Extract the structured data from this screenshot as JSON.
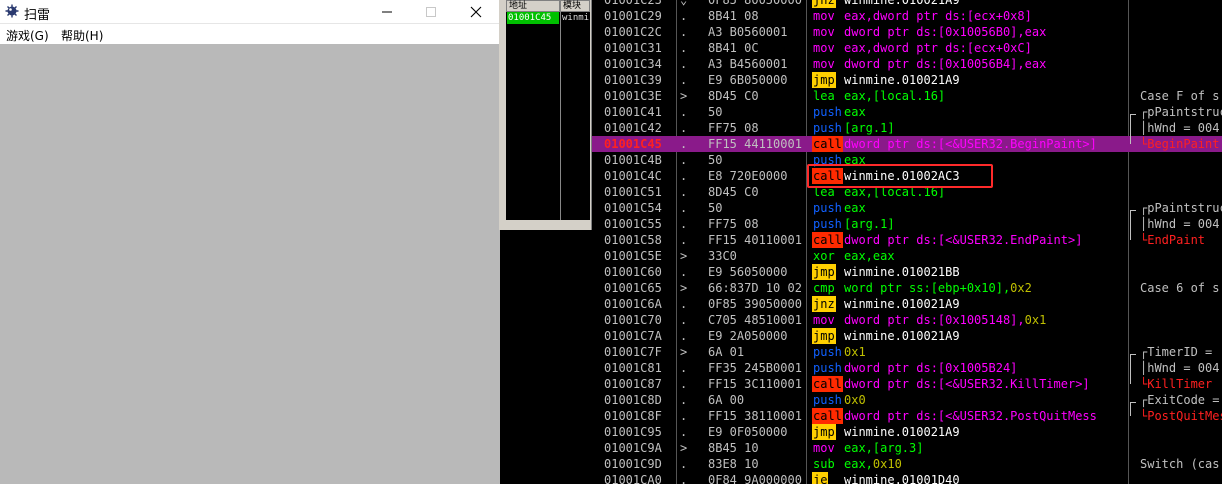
{
  "window": {
    "title": "扫雷",
    "menu": [
      "游戏(G)",
      "帮助(H)"
    ]
  },
  "memory_panel": {
    "col_address": "地址",
    "col_module": "模块",
    "row_address": "01001C45",
    "row_module": "winmi"
  },
  "rows": [
    {
      "addr": "01001C23",
      "jump": "⌄",
      "hex": "0F85 80050000",
      "mn": "jnz",
      "mnc": "jnzn",
      "op": [
        [
          "winmine.010021A9",
          "w"
        ]
      ],
      "cm": ""
    },
    {
      "addr": "01001C29",
      "jump": ".",
      "hex": "8B41 08",
      "mn": "mov",
      "mnc": "mov",
      "op": [
        [
          "eax,dword ptr ds:[ecx+0x8]",
          "mov"
        ]
      ],
      "cm": ""
    },
    {
      "addr": "01001C2C",
      "jump": ".",
      "hex": "A3 B0560001",
      "mn": "mov",
      "mnc": "mov",
      "op": [
        [
          "dword ptr ds:[0x10056B0],eax",
          "mov"
        ]
      ],
      "cm": ""
    },
    {
      "addr": "01001C31",
      "jump": ".",
      "hex": "8B41 0C",
      "mn": "mov",
      "mnc": "mov",
      "op": [
        [
          "eax,dword ptr ds:[ecx+0xC]",
          "mov"
        ]
      ],
      "cm": ""
    },
    {
      "addr": "01001C34",
      "jump": ".",
      "hex": "A3 B4560001",
      "mn": "mov",
      "mnc": "mov",
      "op": [
        [
          "dword ptr ds:[0x10056B4],eax",
          "mov"
        ]
      ],
      "cm": ""
    },
    {
      "addr": "01001C39",
      "jump": ".",
      "hex": "E9 6B050000",
      "mn": "jmp",
      "mnc": "jmpn",
      "op": [
        [
          "winmine.010021A9",
          "w"
        ]
      ],
      "cm": ""
    },
    {
      "addr": "01001C3E",
      "jump": ">",
      "hex": "8D45 C0",
      "mn": "lea",
      "mnc": "lea",
      "op": [
        [
          "eax,[local.16]",
          "g"
        ]
      ],
      "cm": "Case F of s",
      "cmc": "cw"
    },
    {
      "addr": "01001C41",
      "jump": ".",
      "hex": "50",
      "mn": "push",
      "mnc": "push",
      "op": [
        [
          "eax",
          "g"
        ]
      ],
      "cm": "┌pPaintstruc",
      "cmc": "cw"
    },
    {
      "addr": "01001C42",
      "jump": ".",
      "hex": "FF75 08",
      "mn": "push",
      "mnc": "push",
      "op": [
        [
          "[arg.1]",
          "g"
        ]
      ],
      "cm": "│hWnd = 004",
      "cmc": "cw"
    },
    {
      "addr": "01001C45",
      "jump": ".",
      "hex": "FF15 44110001",
      "mn": "call",
      "mnc": "calln",
      "op": [
        [
          "dword ptr ds:[<&USER32.BeginPaint>]",
          "mov"
        ]
      ],
      "cm": "└BeginPaint",
      "cmc": "cr",
      "sel": true
    },
    {
      "addr": "01001C4B",
      "jump": ".",
      "hex": "50",
      "mn": "push",
      "mnc": "push",
      "op": [
        [
          "eax",
          "g"
        ]
      ],
      "cm": ""
    },
    {
      "addr": "01001C4C",
      "jump": ".",
      "hex": "E8 720E0000",
      "mn": "call",
      "mnc": "calln",
      "op": [
        [
          "winmine.01002AC3",
          "w"
        ]
      ],
      "cm": ""
    },
    {
      "addr": "01001C51",
      "jump": ".",
      "hex": "8D45 C0",
      "mn": "lea",
      "mnc": "lea",
      "op": [
        [
          "eax,[local.16]",
          "g"
        ]
      ],
      "cm": ""
    },
    {
      "addr": "01001C54",
      "jump": ".",
      "hex": "50",
      "mn": "push",
      "mnc": "push",
      "op": [
        [
          "eax",
          "g"
        ]
      ],
      "cm": "┌pPaintstruc",
      "cmc": "cw"
    },
    {
      "addr": "01001C55",
      "jump": ".",
      "hex": "FF75 08",
      "mn": "push",
      "mnc": "push",
      "op": [
        [
          "[arg.1]",
          "g"
        ]
      ],
      "cm": "│hWnd = 004",
      "cmc": "cw"
    },
    {
      "addr": "01001C58",
      "jump": ".",
      "hex": "FF15 40110001",
      "mn": "call",
      "mnc": "calln",
      "op": [
        [
          "dword ptr ds:[<&USER32.EndPaint>]",
          "mov"
        ]
      ],
      "cm": "└EndPaint",
      "cmc": "cr"
    },
    {
      "addr": "01001C5E",
      "jump": ">",
      "hex": "33C0",
      "mn": "xor",
      "mnc": "xor",
      "op": [
        [
          "eax,eax",
          "g"
        ]
      ],
      "cm": ""
    },
    {
      "addr": "01001C60",
      "jump": ".",
      "hex": "E9 56050000",
      "mn": "jmp",
      "mnc": "jmpn",
      "op": [
        [
          "winmine.010021BB",
          "w"
        ]
      ],
      "cm": ""
    },
    {
      "addr": "01001C65",
      "jump": ">",
      "hex": "66:837D 10 02",
      "mn": "cmp",
      "mnc": "cmp",
      "op": [
        [
          "word ptr ss:[ebp+0x10],",
          "g"
        ],
        [
          "0x2",
          "y"
        ]
      ],
      "cm": "Case 6 of s",
      "cmc": "cw"
    },
    {
      "addr": "01001C6A",
      "jump": ".",
      "hex": "0F85 39050000",
      "mn": "jnz",
      "mnc": "jnzn",
      "op": [
        [
          "winmine.010021A9",
          "w"
        ]
      ],
      "cm": ""
    },
    {
      "addr": "01001C70",
      "jump": ".",
      "hex": "C705 48510001",
      "mn": "mov",
      "mnc": "mov",
      "op": [
        [
          "dword ptr ds:[0x1005148],",
          "mov"
        ],
        [
          "0x1",
          "y"
        ]
      ],
      "cm": ""
    },
    {
      "addr": "01001C7A",
      "jump": ".",
      "hex": "E9 2A050000",
      "mn": "jmp",
      "mnc": "jmpn",
      "op": [
        [
          "winmine.010021A9",
          "w"
        ]
      ],
      "cm": ""
    },
    {
      "addr": "01001C7F",
      "jump": ">",
      "hex": "6A 01",
      "mn": "push",
      "mnc": "push",
      "op": [
        [
          "0x1",
          "y"
        ]
      ],
      "cm": "┌TimerID =",
      "cmc": "cw"
    },
    {
      "addr": "01001C81",
      "jump": ".",
      "hex": "FF35 245B0001",
      "mn": "push",
      "mnc": "push",
      "op": [
        [
          "dword ptr ds:[0x1005B24]",
          "mov"
        ]
      ],
      "cm": "│hWnd = 004",
      "cmc": "cw"
    },
    {
      "addr": "01001C87",
      "jump": ".",
      "hex": "FF15 3C110001",
      "mn": "call",
      "mnc": "calln",
      "op": [
        [
          "dword ptr ds:[<&USER32.KillTimer>]",
          "mov"
        ]
      ],
      "cm": "└KillTimer",
      "cmc": "cr"
    },
    {
      "addr": "01001C8D",
      "jump": ".",
      "hex": "6A 00",
      "mn": "push",
      "mnc": "push",
      "op": [
        [
          "0x0",
          "y"
        ]
      ],
      "cm": "┌ExitCode =",
      "cmc": "cw"
    },
    {
      "addr": "01001C8F",
      "jump": ".",
      "hex": "FF15 38110001",
      "mn": "call",
      "mnc": "calln",
      "op": [
        [
          "dword ptr ds:[<&USER32.PostQuitMess",
          "mov"
        ]
      ],
      "cm": "└PostQuitMes",
      "cmc": "cr"
    },
    {
      "addr": "01001C95",
      "jump": ".",
      "hex": "E9 0F050000",
      "mn": "jmp",
      "mnc": "jmpn",
      "op": [
        [
          "winmine.010021A9",
          "w"
        ]
      ],
      "cm": ""
    },
    {
      "addr": "01001C9A",
      "jump": ">",
      "hex": "8B45 10",
      "mn": "mov",
      "mnc": "mov",
      "op": [
        [
          "eax,[arg.3]",
          "g"
        ]
      ],
      "cm": ""
    },
    {
      "addr": "01001C9D",
      "jump": ".",
      "hex": "83E8 10",
      "mn": "sub",
      "mnc": "sub",
      "op": [
        [
          "eax,",
          "g"
        ],
        [
          "0x10",
          "y"
        ]
      ],
      "cm": "Switch (cas",
      "cmc": "cw"
    },
    {
      "addr": "01001CA0",
      "jump": ".",
      "hex": "0F84 9A000000",
      "mn": "je",
      "mnc": "jen",
      "op": [
        [
          "winmine.01001D40",
          "w"
        ]
      ],
      "cm": ""
    }
  ]
}
